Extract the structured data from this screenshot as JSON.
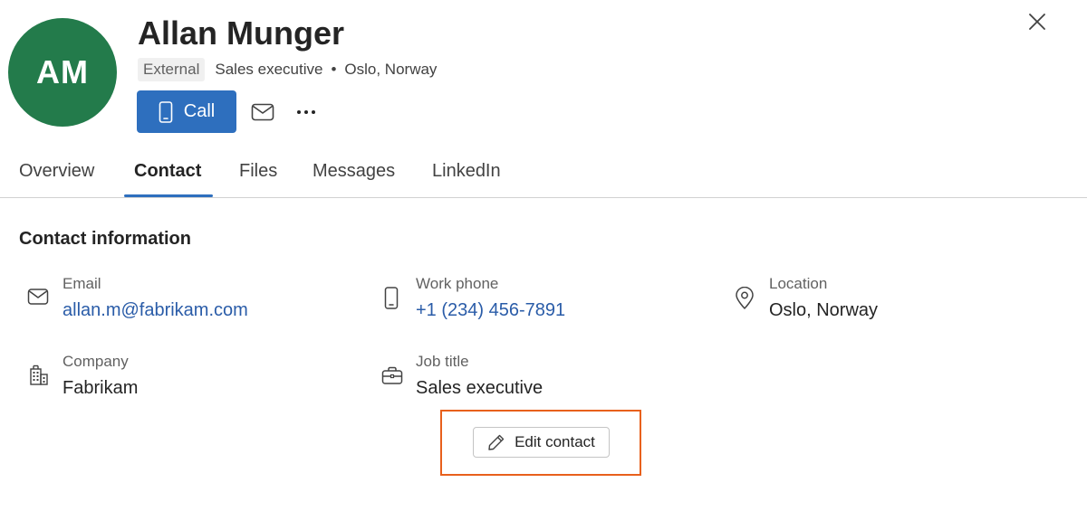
{
  "profile": {
    "initials": "AM",
    "avatar_color": "#237b4b",
    "name": "Allan Munger",
    "badge": "External",
    "title": "Sales executive",
    "separator": "•",
    "location": "Oslo, Norway"
  },
  "actions": {
    "call_label": "Call",
    "accent_color": "#2e6fbe"
  },
  "tabs": [
    {
      "label": "Overview",
      "active": false
    },
    {
      "label": "Contact",
      "active": true
    },
    {
      "label": "Files",
      "active": false
    },
    {
      "label": "Messages",
      "active": false
    },
    {
      "label": "LinkedIn",
      "active": false
    }
  ],
  "contact": {
    "section_title": "Contact information",
    "email": {
      "label": "Email",
      "value": "allan.m@fabrikam.com",
      "icon": "mail-icon"
    },
    "work_phone": {
      "label": "Work phone",
      "value": "+1 (234) 456-7891",
      "icon": "phone-icon"
    },
    "location": {
      "label": "Location",
      "value": "Oslo, Norway",
      "icon": "location-pin-icon"
    },
    "company": {
      "label": "Company",
      "value": "Fabrikam",
      "icon": "building-icon"
    },
    "job_title": {
      "label": "Job title",
      "value": "Sales executive",
      "icon": "briefcase-icon"
    },
    "edit_label": "Edit contact",
    "highlight_color": "#e8601c"
  }
}
